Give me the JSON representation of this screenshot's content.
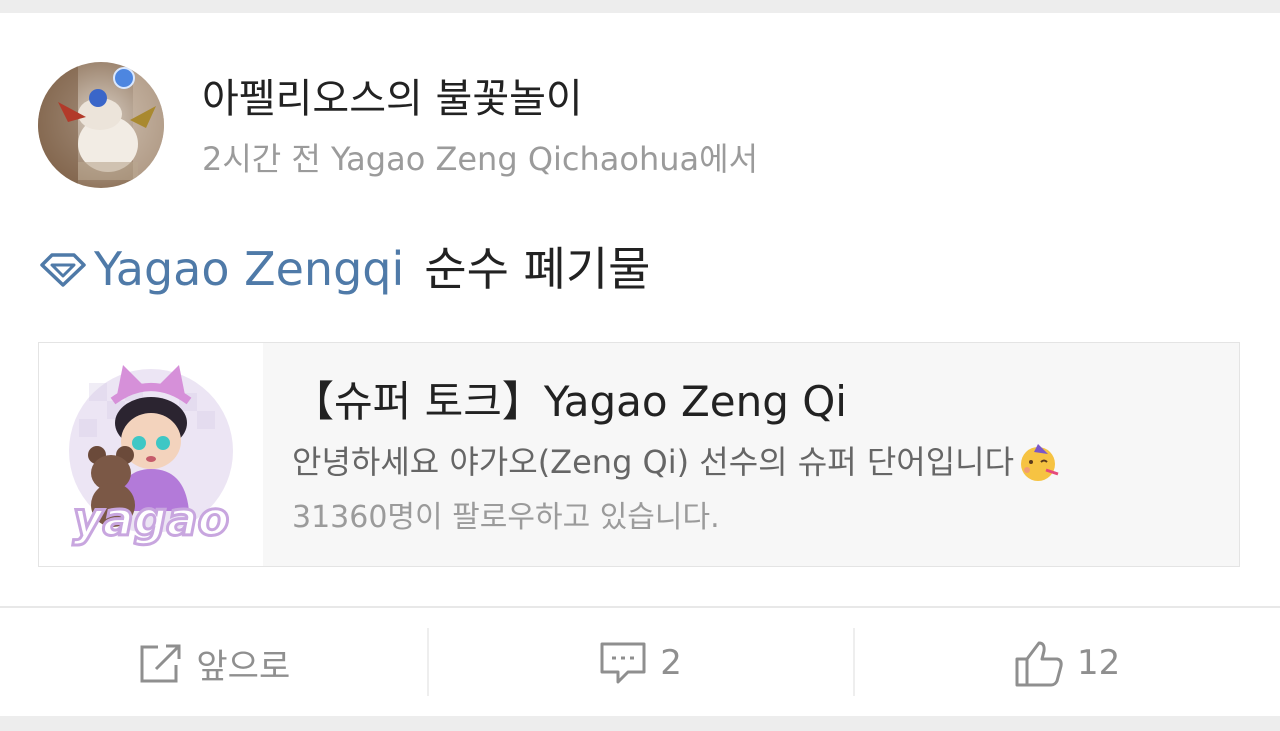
{
  "post": {
    "author": "아펠리오스의 불꽃놀이",
    "meta": "2시간 전 Yagao Zeng Qichaohua에서",
    "topic_link": "Yagao Zengqi",
    "text": "순수 폐기물"
  },
  "topic_card": {
    "title": "【슈퍼 토크】Yagao Zeng Qi",
    "description": "안녕하세요 야가오(Zeng Qi) 선수의 슈퍼 단어입니다",
    "followers": "31360명이 팔로우하고 있습니다.",
    "thumbnail_text": "yagao"
  },
  "actions": {
    "forward_label": "앞으로",
    "comment_count": "2",
    "like_count": "12"
  },
  "colors": {
    "topic_link": "#4f7aa8",
    "text": "#222222",
    "muted": "#9b9b9b"
  },
  "icons": {
    "topic": "supertopic-diamond-icon",
    "forward": "forward-icon",
    "comment": "comment-icon",
    "like": "thumbs-up-icon",
    "emoji": "partying-face-emoji"
  }
}
